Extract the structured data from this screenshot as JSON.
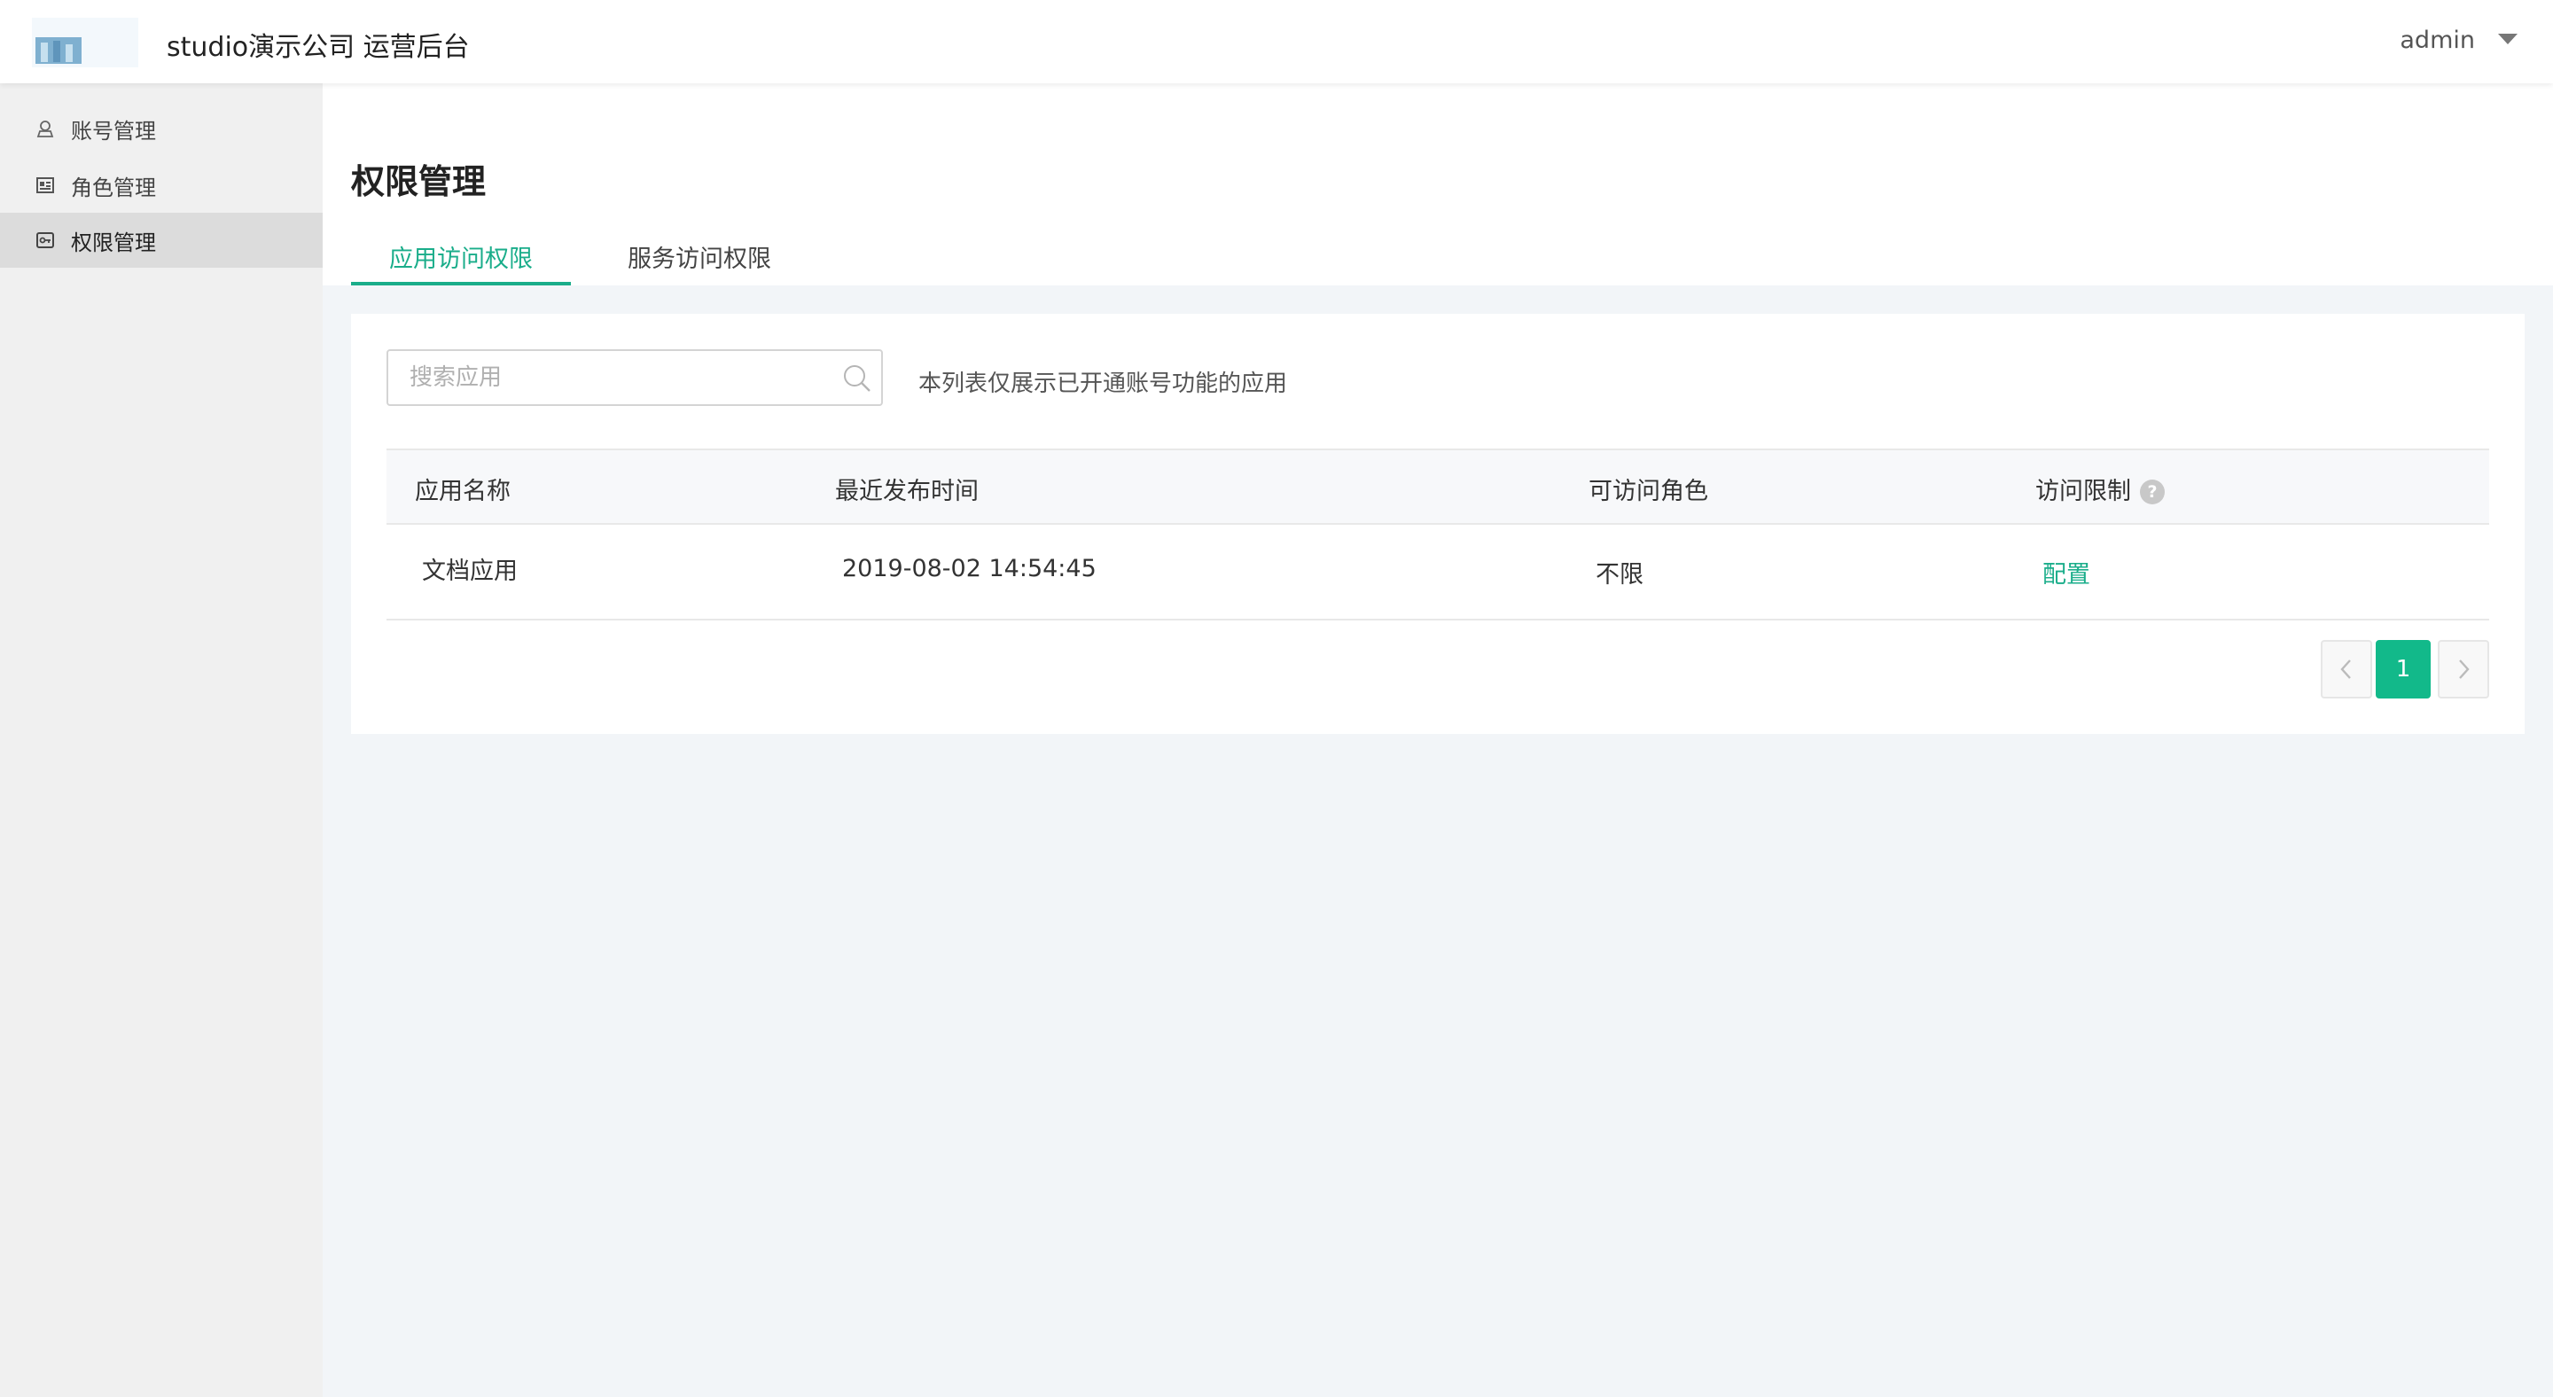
{
  "header": {
    "app_title": "studio演示公司 运营后台",
    "user_name": "admin"
  },
  "sidebar": {
    "items": [
      {
        "label": "账号管理",
        "icon": "user-icon",
        "active": false
      },
      {
        "label": "角色管理",
        "icon": "id-card-icon",
        "active": false
      },
      {
        "label": "权限管理",
        "icon": "key-card-icon",
        "active": true
      }
    ]
  },
  "page": {
    "title": "权限管理",
    "tabs": [
      {
        "label": "应用访问权限",
        "active": true
      },
      {
        "label": "服务访问权限",
        "active": false
      }
    ]
  },
  "toolbar": {
    "search_placeholder": "搜索应用",
    "search_value": "",
    "hint": "本列表仅展示已开通账号功能的应用"
  },
  "table": {
    "columns": [
      "应用名称",
      "最近发布时间",
      "可访问角色",
      "访问限制"
    ],
    "rows": [
      {
        "name": "文档应用",
        "published": "2019-08-02 14:54:45",
        "roles": "不限",
        "action": "配置"
      }
    ]
  },
  "pagination": {
    "current_page": "1"
  },
  "colors": {
    "accent": "#1aad8a",
    "pager_active": "#12b98a",
    "background": "#f2f5f8"
  }
}
